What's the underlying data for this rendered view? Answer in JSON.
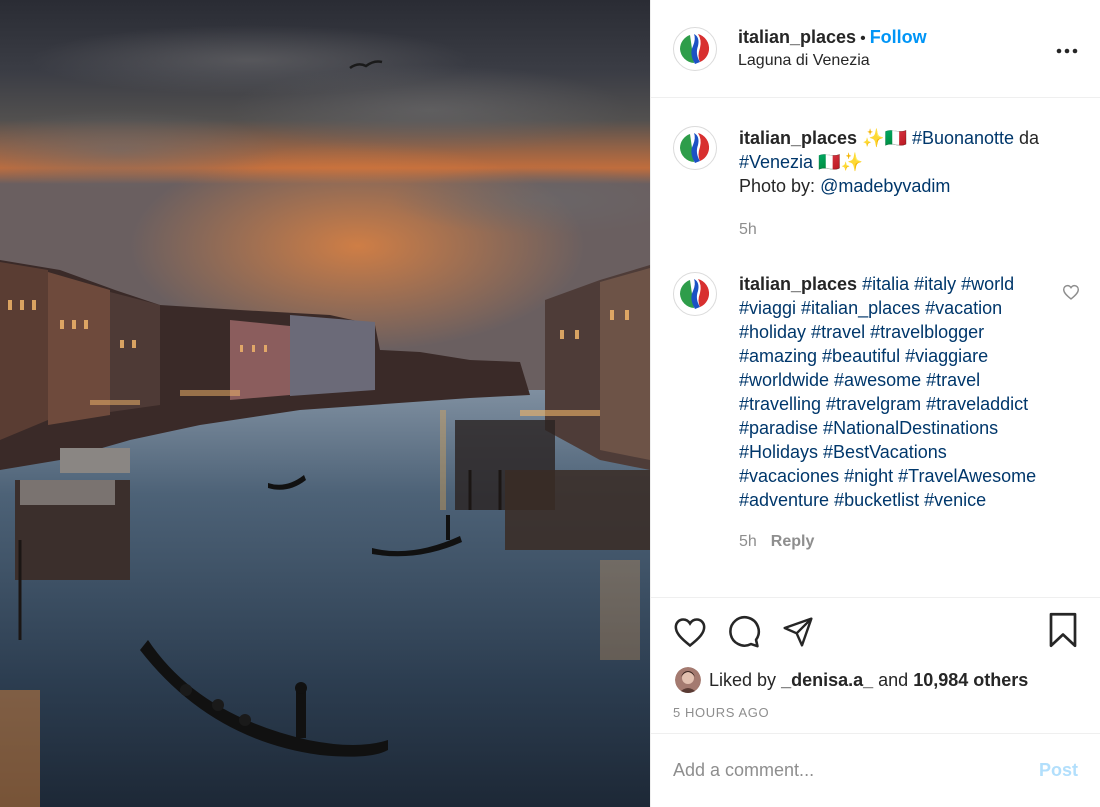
{
  "post": {
    "username": "italian_places",
    "separator": "•",
    "follow_label": "Follow",
    "location": "Laguna di Venezia",
    "more_icon": "more-horizontal-icon"
  },
  "caption": {
    "username": "italian_places",
    "line1_emoji": "✨🇮🇹",
    "tag1": "#Buonanotte",
    "text1": "da",
    "tag2": "#Venezia",
    "line2_emoji": "🇮🇹✨",
    "photo_by": "Photo by:",
    "mention": "@madebyvadim",
    "time": "5h"
  },
  "comment": {
    "username": "italian_places",
    "tags": "#italia #italy #world #viaggi #italian_places #vacation #holiday #travel #travelblogger #amazing #beautiful #viaggiare #worldwide #awesome #travel #travelling #travelgram #traveladdict #paradise #NationalDestinations #Holidays #BestVacations #vacaciones #night #TravelAwesome #adventure #bucketlist #venice",
    "time": "5h",
    "reply_label": "Reply"
  },
  "likes": {
    "prefix": "Liked by",
    "liker": "_denisa.a_",
    "and": "and",
    "others": "10,984 others"
  },
  "timestamp": "5 HOURS AGO",
  "add_comment": {
    "placeholder": "Add a comment...",
    "post_label": "Post"
  },
  "colors": {
    "link": "#00376b",
    "follow": "#0095f6",
    "post_disabled": "#b2dffc"
  }
}
